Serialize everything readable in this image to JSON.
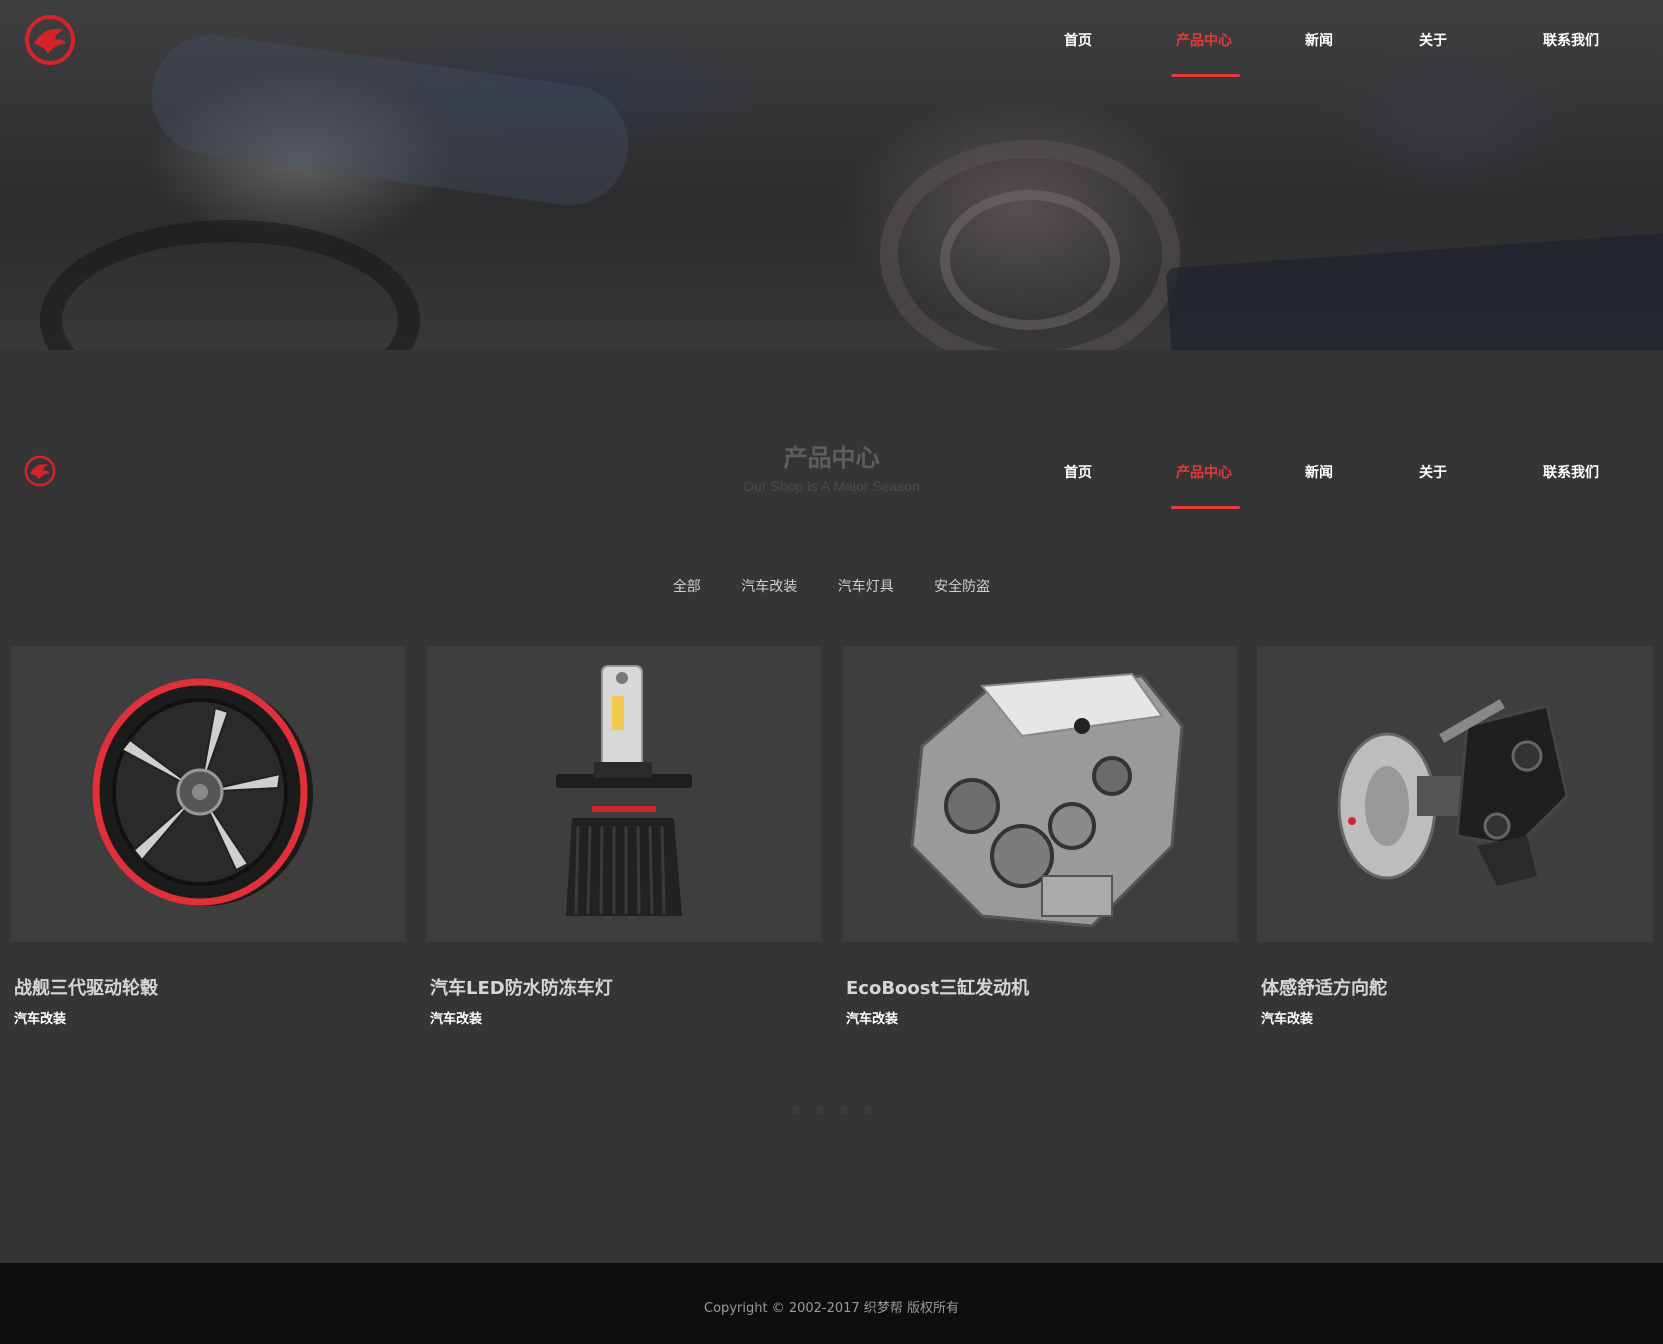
{
  "nav": {
    "items": [
      {
        "label": "首页",
        "active": false
      },
      {
        "label": "产品中心",
        "active": true
      },
      {
        "label": "新闻",
        "active": false
      },
      {
        "label": "关于",
        "active": false
      },
      {
        "label": "联系我们",
        "active": false
      }
    ]
  },
  "section": {
    "title": "产品中心",
    "subtitle": "Our Shop Is A Major Season"
  },
  "filters": [
    "全部",
    "汽车改装",
    "汽车灯具",
    "安全防盗"
  ],
  "products": [
    {
      "name": "战舰三代驱动轮毂",
      "category": "汽车改装",
      "image": "wheel-rim"
    },
    {
      "name": "汽车LED防水防冻车灯",
      "category": "汽车改装",
      "image": "led-headlight-bulb"
    },
    {
      "name": "EcoBoost三缸发动机",
      "category": "汽车改装",
      "image": "engine"
    },
    {
      "name": "体感舒适方向舵",
      "category": "汽车改装",
      "image": "brake-caliper"
    }
  ],
  "footer": {
    "copyright": "Copyright © 2002-2017 织梦帮 版权所有"
  },
  "colors": {
    "accent": "#e33a3a",
    "page_bg": "#353535",
    "footer_bg": "#0e0e0e"
  }
}
